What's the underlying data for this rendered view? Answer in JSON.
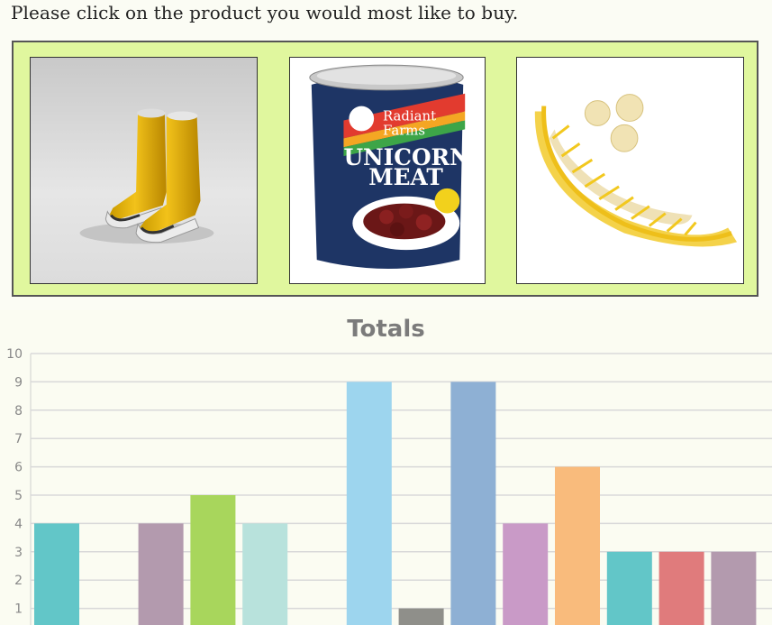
{
  "prompt": "Please click on the product you would most like to buy.",
  "products": [
    {
      "name": "yellow-rain-boots"
    },
    {
      "name": "unicorn-meat-can",
      "brand_line1": "Radiant",
      "brand_line2": "Farms",
      "title_line1": "UNICORN",
      "title_line2": "MEAT"
    },
    {
      "name": "banana-slicer"
    }
  ],
  "chart_data": {
    "type": "bar",
    "title": "Totals",
    "ylim": [
      0,
      10
    ],
    "yticks": [
      1,
      2,
      3,
      4,
      5,
      6,
      7,
      8,
      9,
      10
    ],
    "grid": true,
    "values": [
      4,
      0,
      4,
      5,
      4,
      0,
      9,
      1,
      9,
      4,
      6,
      3,
      3,
      3
    ],
    "colors": [
      "#62c6c8",
      "#62c6c8",
      "#b39aae",
      "#a8d65c",
      "#b8e2dc",
      "#b8e2dc",
      "#9dd5ee",
      "#8f8f8a",
      "#8eb0d4",
      "#c99ac7",
      "#f9bb7c",
      "#62c6c8",
      "#e07b7c",
      "#b39aae"
    ]
  }
}
